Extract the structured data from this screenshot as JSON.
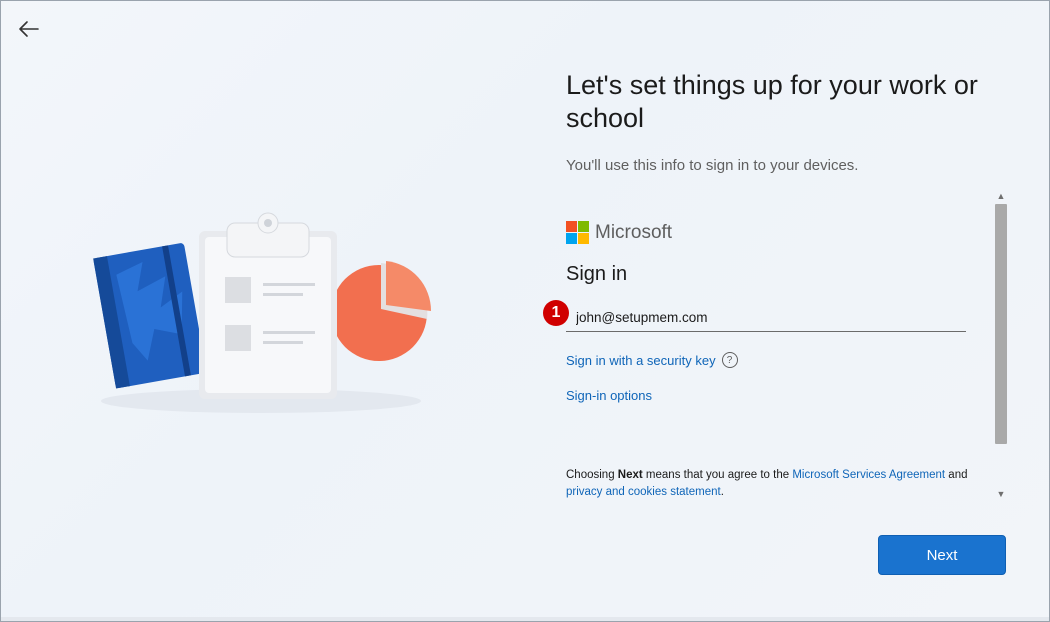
{
  "header": {
    "title": "Let's set things up for your work or school",
    "subtitle": "You'll use this info to sign in to your devices."
  },
  "brand": {
    "name": "Microsoft"
  },
  "signin": {
    "heading": "Sign in",
    "step_badge": "1",
    "email_value": "john@setupmem.com",
    "security_key_link": "Sign in with a security key",
    "options_link": "Sign-in options"
  },
  "agreement": {
    "prefix": "Choosing ",
    "next_word": "Next",
    "middle": " means that you agree to the ",
    "services_link": "Microsoft Services Agreement",
    "and_word": " and",
    "privacy_link": "privacy and cookies statement",
    "end": "."
  },
  "footer": {
    "next_label": "Next"
  },
  "icons": {
    "back": "arrow-left-icon",
    "help": "question-circle-icon",
    "scroll_up": "chevron-up-icon",
    "scroll_down": "chevron-down-icon"
  },
  "colors": {
    "accent": "#1a73cf",
    "link": "#0f65b8",
    "badge": "#d00000",
    "ms_red": "#f25022",
    "ms_green": "#7fba00",
    "ms_blue": "#00a4ef",
    "ms_yellow": "#ffb900"
  }
}
